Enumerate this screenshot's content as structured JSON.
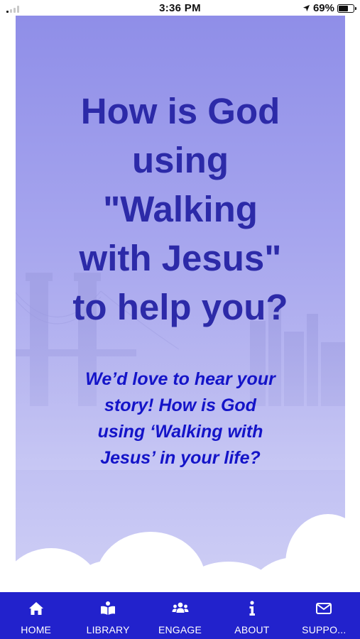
{
  "status_bar": {
    "time": "3:36 PM",
    "battery": "69%",
    "battery_level": 0.69,
    "icons": [
      "signal-icon",
      "location-arrow-icon",
      "battery-icon"
    ]
  },
  "hero": {
    "title": "How is God\nusing\n\"Walking\nwith Jesus\"\nto help you?",
    "subtitle": "We’d love to hear your\nstory! How is God\nusing ‘Walking with\nJesus’ in your life?",
    "colors": {
      "title": "#2c2aa8",
      "subtitle": "#1414c8",
      "sky": "#a6a5ee"
    }
  },
  "tab_bar": {
    "background": "#2222cc",
    "tabs": [
      {
        "label": "HOME",
        "icon": "home-icon"
      },
      {
        "label": "LIBRARY",
        "icon": "library-icon"
      },
      {
        "label": "ENGAGE",
        "icon": "users-icon"
      },
      {
        "label": "ABOUT",
        "icon": "info-icon"
      },
      {
        "label": "SUPPO...",
        "icon": "envelope-icon"
      }
    ]
  }
}
